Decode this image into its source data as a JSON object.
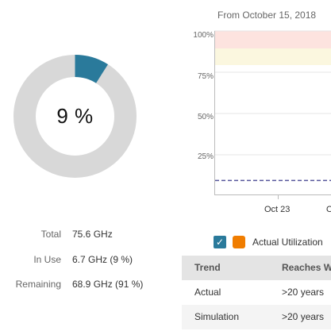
{
  "gauge": {
    "percent": 9,
    "label": "9 %",
    "colors": {
      "used": "#2a7a9b",
      "free": "#d8d8d8"
    }
  },
  "stats": [
    {
      "label": "Total",
      "value": "75.6 GHz"
    },
    {
      "label": "In Use",
      "value": "6.7 GHz (9 %)"
    },
    {
      "label": "Remaining",
      "value": "68.9 GHz (91 %)"
    }
  ],
  "chart": {
    "from_label": "From October 15, 2018",
    "y_ticks": [
      "100%",
      "75%",
      "50%",
      "25%"
    ],
    "x_ticks": [
      "Oct 23",
      "O"
    ],
    "thresholds": {
      "critical_color": "#fde3df",
      "warning_color": "#fbf7df"
    },
    "line_color": "#55559a"
  },
  "chart_data": {
    "type": "line",
    "ylim": [
      0,
      100
    ],
    "ylabel": "",
    "xlabel": "",
    "y_ticks": [
      "100%",
      "75%",
      "50%",
      "25%"
    ],
    "x_ticks": [
      "Oct 23"
    ],
    "bands": [
      {
        "from": 90,
        "to": 100,
        "color": "#fde3df"
      },
      {
        "from": 80,
        "to": 90,
        "color": "#fbf7df"
      }
    ],
    "series": [
      {
        "style": "dashed",
        "color": "#55559a",
        "values": [
          9,
          9
        ]
      }
    ],
    "grid": true
  },
  "legend": {
    "checked": true,
    "swatch_color": "#f07d00",
    "label": "Actual Utilization"
  },
  "trend_table": {
    "headers": [
      "Trend",
      "Reaches W"
    ],
    "rows": [
      [
        "Actual",
        ">20 years"
      ],
      [
        "Simulation",
        ">20 years"
      ]
    ]
  }
}
